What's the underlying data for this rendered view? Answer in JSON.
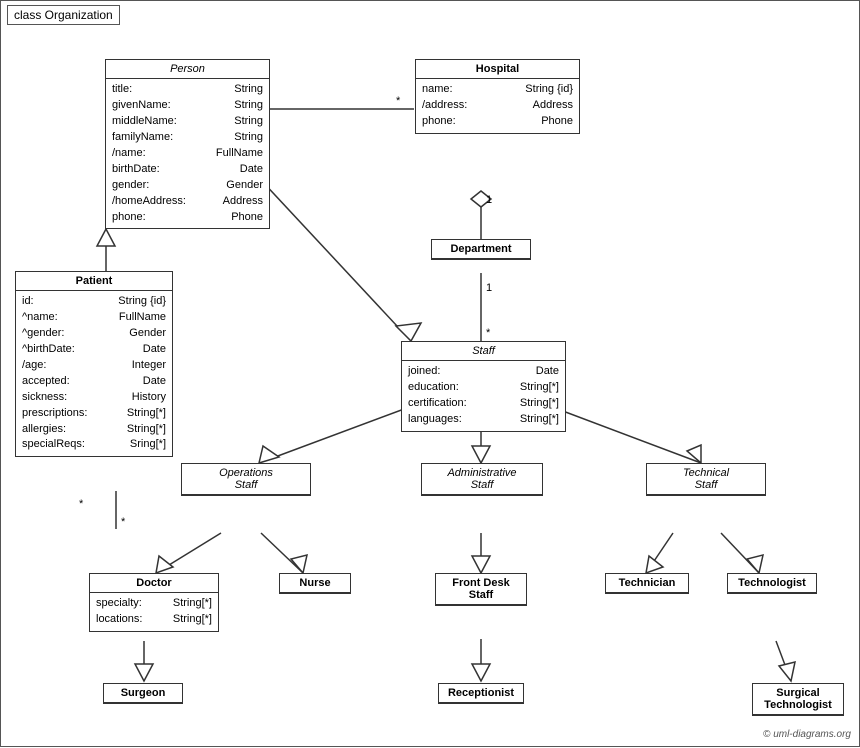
{
  "title": "class Organization",
  "copyright": "© uml-diagrams.org",
  "classes": {
    "person": {
      "name": "Person",
      "attrs": [
        {
          "name": "title:",
          "type": "String"
        },
        {
          "name": "givenName:",
          "type": "String"
        },
        {
          "name": "middleName:",
          "type": "String"
        },
        {
          "name": "familyName:",
          "type": "String"
        },
        {
          "name": "/name:",
          "type": "FullName"
        },
        {
          "name": "birthDate:",
          "type": "Date"
        },
        {
          "name": "gender:",
          "type": "Gender"
        },
        {
          "name": "/homeAddress:",
          "type": "Address"
        },
        {
          "name": "phone:",
          "type": "Phone"
        }
      ]
    },
    "hospital": {
      "name": "Hospital",
      "attrs": [
        {
          "name": "name:",
          "type": "String {id}"
        },
        {
          "name": "/address:",
          "type": "Address"
        },
        {
          "name": "phone:",
          "type": "Phone"
        }
      ]
    },
    "department": {
      "name": "Department",
      "attrs": []
    },
    "staff": {
      "name": "Staff",
      "attrs": [
        {
          "name": "joined:",
          "type": "Date"
        },
        {
          "name": "education:",
          "type": "String[*]"
        },
        {
          "name": "certification:",
          "type": "String[*]"
        },
        {
          "name": "languages:",
          "type": "String[*]"
        }
      ]
    },
    "patient": {
      "name": "Patient",
      "attrs": [
        {
          "name": "id:",
          "type": "String {id}"
        },
        {
          "name": "^name:",
          "type": "FullName"
        },
        {
          "name": "^gender:",
          "type": "Gender"
        },
        {
          "name": "^birthDate:",
          "type": "Date"
        },
        {
          "name": "/age:",
          "type": "Integer"
        },
        {
          "name": "accepted:",
          "type": "Date"
        },
        {
          "name": "sickness:",
          "type": "History"
        },
        {
          "name": "prescriptions:",
          "type": "String[*]"
        },
        {
          "name": "allergies:",
          "type": "String[*]"
        },
        {
          "name": "specialReqs:",
          "type": "Sring[*]"
        }
      ]
    },
    "operations_staff": {
      "name": "Operations Staff",
      "italic": true
    },
    "administrative_staff": {
      "name": "Administrative Staff",
      "italic": true
    },
    "technical_staff": {
      "name": "Technical Staff",
      "italic": true
    },
    "doctor": {
      "name": "Doctor",
      "attrs": [
        {
          "name": "specialty:",
          "type": "String[*]"
        },
        {
          "name": "locations:",
          "type": "String[*]"
        }
      ]
    },
    "nurse": {
      "name": "Nurse",
      "attrs": []
    },
    "front_desk_staff": {
      "name": "Front Desk Staff",
      "attrs": []
    },
    "technician": {
      "name": "Technician",
      "attrs": []
    },
    "technologist": {
      "name": "Technologist",
      "attrs": []
    },
    "surgeon": {
      "name": "Surgeon",
      "attrs": []
    },
    "receptionist": {
      "name": "Receptionist",
      "attrs": []
    },
    "surgical_technologist": {
      "name": "Surgical Technologist",
      "attrs": []
    }
  }
}
